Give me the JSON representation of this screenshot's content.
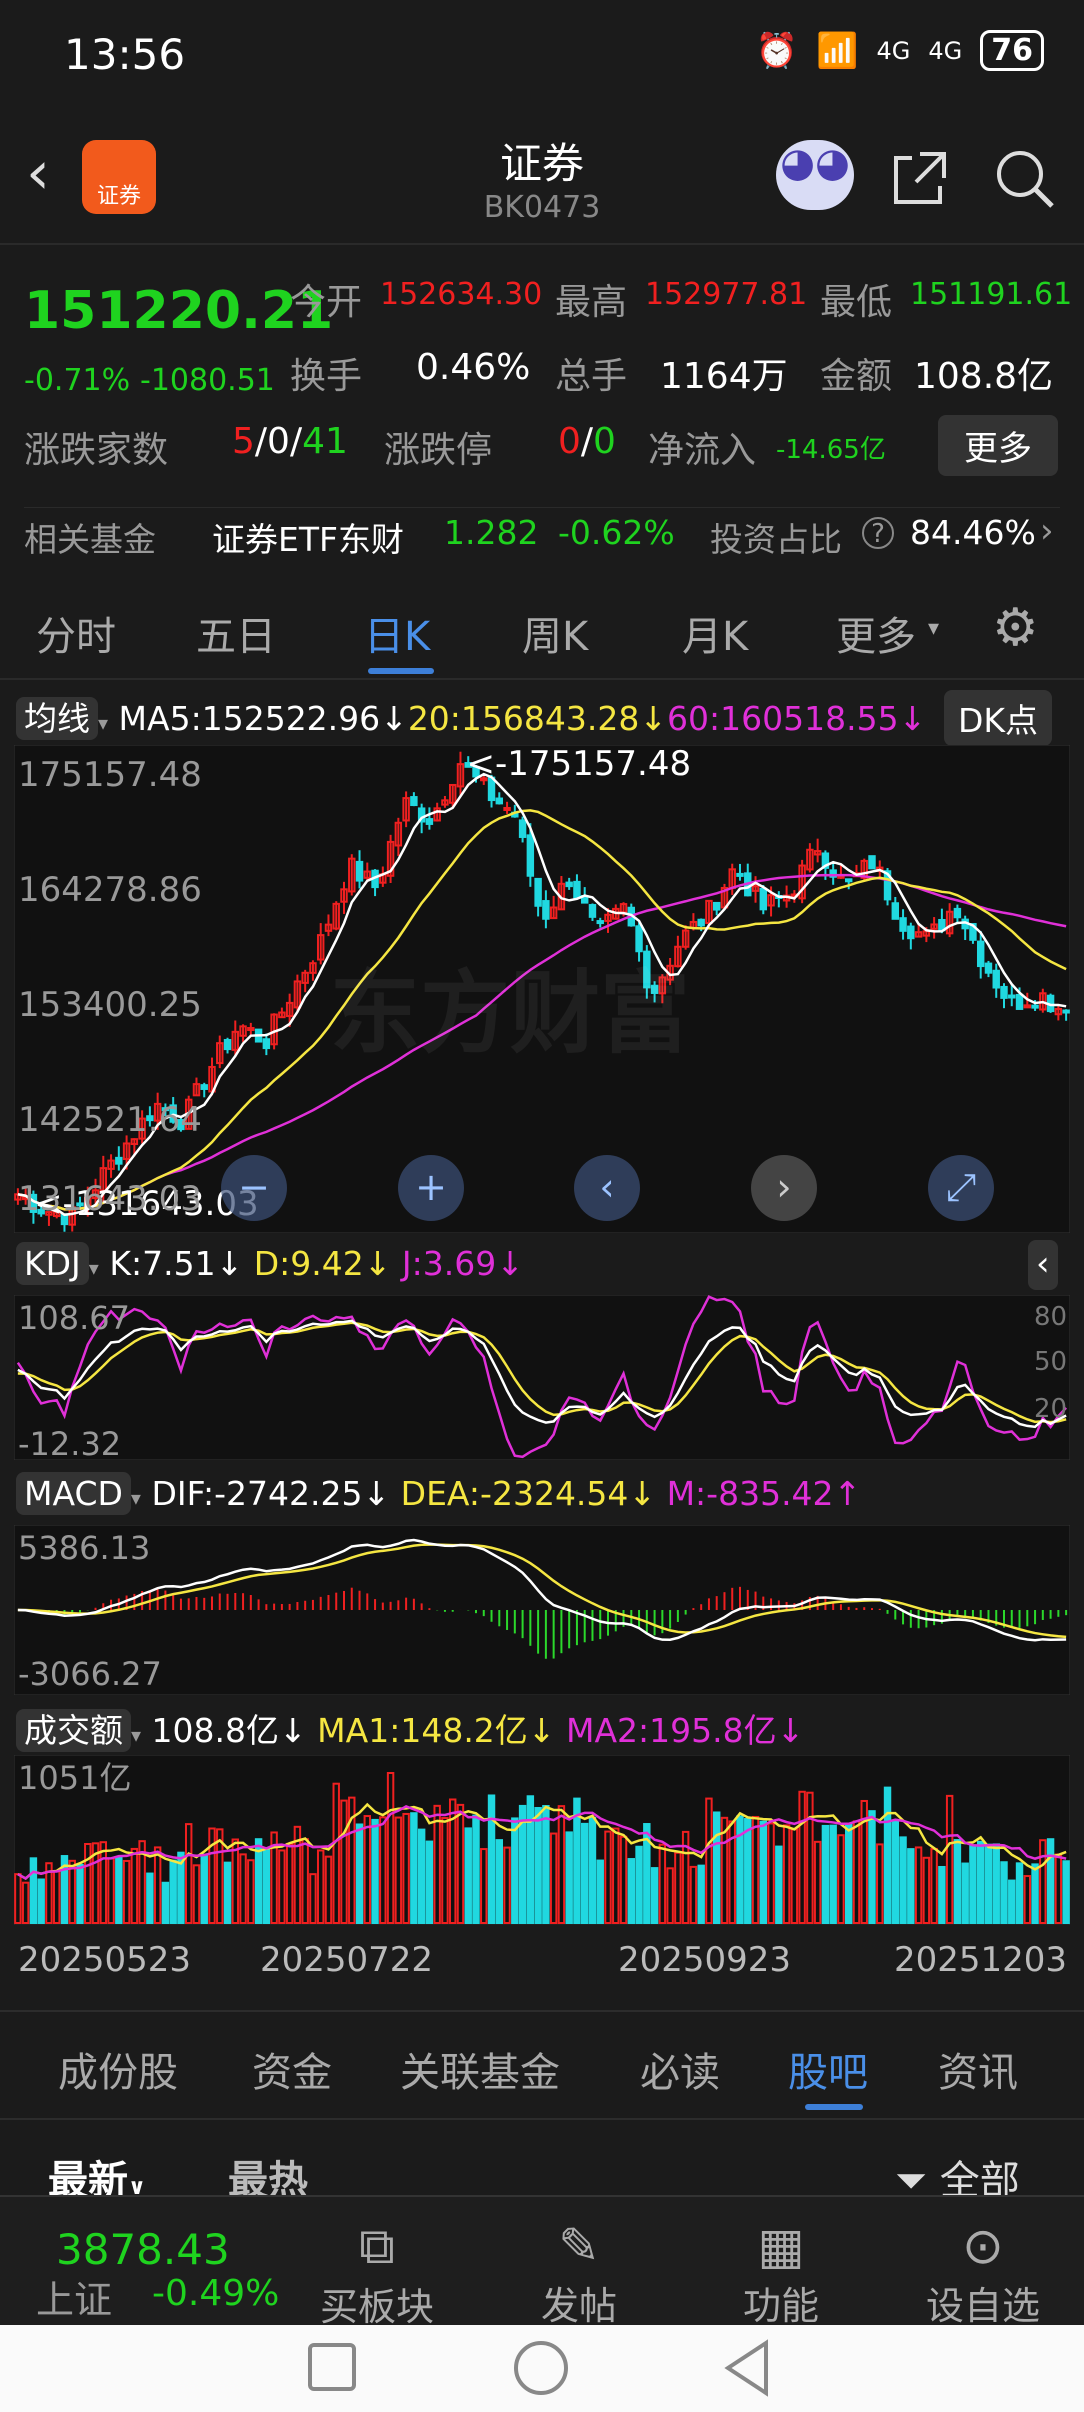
{
  "status": {
    "time": "13:56",
    "net1": "4G",
    "net2": "4G",
    "battery": "76"
  },
  "header": {
    "title": "证券",
    "code": "BK0473",
    "logo": "证券"
  },
  "quote": {
    "price": "151220.21",
    "pct": "-0.71%",
    "chg": "-1080.51",
    "open_label": "今开",
    "open": "152634.30",
    "high_label": "最高",
    "high": "152977.81",
    "low_label": "最低",
    "low": "151191.61",
    "turn_label": "换手",
    "turn": "0.46%",
    "vol_label": "总手",
    "vol": "1164万",
    "amt_label": "金额",
    "amt": "108.8亿",
    "ud_label": "涨跌家数",
    "up": "5",
    "flat": "/0/",
    "down": "41",
    "limit_label": "涨跌停",
    "lup": "0",
    "lsep": "/",
    "ldown": "0",
    "flow_label": "净流入",
    "flow": "-14.65亿",
    "more": "更多",
    "fund_label": "相关基金",
    "fund_name": "证券ETF东财",
    "fund_price": "1.282",
    "fund_pct": "-0.62%",
    "ratio_label": "投资占比",
    "ratio": "84.46%"
  },
  "tabs": [
    "分时",
    "五日",
    "日K",
    "周K",
    "月K",
    "更多"
  ],
  "active_tab": 2,
  "ma_legend": {
    "btn": "均线",
    "ma5": "MA5:152522.96↓",
    "ma20": "20:156843.28↓",
    "ma60": "60:160518.55↓",
    "dk": "DK点"
  },
  "kdj_legend": {
    "btn": "KDJ",
    "k": "K:7.51↓",
    "d": "D:9.42↓",
    "j": "J:3.69↓"
  },
  "macd_legend": {
    "btn": "MACD",
    "dif": "DIF:-2742.25↓",
    "dea": "DEA:-2324.54↓",
    "m": "M:-835.42↑"
  },
  "vol_legend": {
    "btn": "成交额",
    "v": "108.8亿↓",
    "ma1": "MA1:148.2亿↓",
    "ma2": "MA2:195.8亿↓"
  },
  "watermark": "东方财富",
  "chart_data": {
    "type": "candlestick",
    "price_axis": [
      "175157.48",
      "164278.86",
      "153400.25",
      "142521.64",
      "131643.03"
    ],
    "ylim": [
      131643.03,
      175157.48
    ],
    "max_label": "<-175157.48",
    "min_label": "<-131643.03",
    "kdj_axis": [
      "108.67",
      "-12.32"
    ],
    "kdj_right": [
      "80",
      "50",
      "20"
    ],
    "macd_axis": [
      "5386.13",
      "-3066.27"
    ],
    "vol_axis": "1051亿",
    "dates": [
      "20250523",
      "20250722",
      "20250923",
      "20251203"
    ],
    "keypoints_close": [
      134000,
      132500,
      131900,
      135500,
      139000,
      142500,
      141000,
      146000,
      150000,
      148500,
      153400,
      158000,
      165000,
      163000,
      171000,
      169500,
      175000,
      172000,
      170000,
      160000,
      164000,
      158500,
      161000,
      153000,
      158000,
      160500,
      165000,
      161000,
      162500,
      167000,
      163000,
      165500,
      160000,
      158000,
      161500,
      156000,
      152000,
      153000,
      151220
    ],
    "colors": {
      "up": "#f02020",
      "down": "#20d8e0",
      "ma5": "#ffffff",
      "ma20": "#f5e642",
      "ma60": "#e030d8"
    }
  },
  "bottom_tabs": [
    "成份股",
    "资金",
    "关联基金",
    "必读",
    "股吧",
    "资讯"
  ],
  "bottom_active": 4,
  "sub": {
    "latest": "最新",
    "hot": "最热",
    "all": "全部"
  },
  "nav": {
    "index_value": "3878.43",
    "index_name": "上证",
    "index_pct": "-0.49%",
    "items": [
      "买板块",
      "发帖",
      "功能",
      "设自选"
    ]
  }
}
